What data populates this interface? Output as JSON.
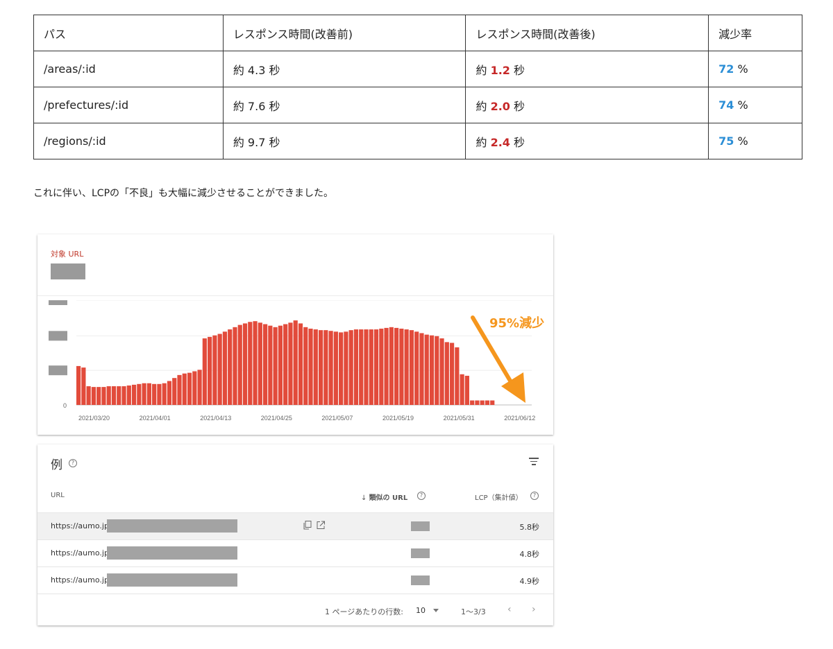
{
  "table": {
    "headers": [
      "パス",
      "レスポンス時間(改善前)",
      "レスポンス時間(改善後)",
      "減少率"
    ],
    "rows": [
      {
        "path": "/areas/:id",
        "before": "約 4.3 秒",
        "after_prefix": "約 ",
        "after_value": "1.2",
        "after_suffix": " 秒",
        "rate_value": "72",
        "rate_suffix": " %"
      },
      {
        "path": "/prefectures/:id",
        "before": "約 7.6 秒",
        "after_prefix": "約 ",
        "after_value": "2.0",
        "after_suffix": " 秒",
        "rate_value": "74",
        "rate_suffix": " %"
      },
      {
        "path": "/regions/:id",
        "before": "約 9.7 秒",
        "after_prefix": "約 ",
        "after_value": "2.4",
        "after_suffix": " 秒",
        "rate_value": "75",
        "rate_suffix": " %"
      }
    ],
    "after_color": "#c62828",
    "rate_color": "#2b8ed6"
  },
  "paragraph": "これに伴い、LCPの「不良」も大幅に減少させることができました。",
  "chart_card": {
    "target_label": "対象 URL",
    "annotation": "95%減少",
    "annotation_color": "#f5961d",
    "y_zero_label": "0"
  },
  "chart_data": {
    "type": "bar",
    "bar_color": "#e24b3b",
    "x_tick_labels": [
      "2021/03/20",
      "2021/04/01",
      "2021/04/13",
      "2021/04/25",
      "2021/05/07",
      "2021/05/19",
      "2021/05/31",
      "2021/06/12"
    ],
    "values": [
      52,
      50,
      25,
      24,
      24,
      24,
      25,
      25,
      25,
      25,
      26,
      27,
      28,
      29,
      29,
      28,
      28,
      29,
      32,
      36,
      40,
      42,
      43,
      45,
      47,
      89,
      91,
      93,
      95,
      98,
      101,
      104,
      107,
      109,
      111,
      112,
      110,
      108,
      106,
      104,
      106,
      108,
      110,
      113,
      109,
      104,
      102,
      101,
      100,
      100,
      99,
      98,
      97,
      98,
      100,
      101,
      101,
      101,
      101,
      101,
      102,
      103,
      104,
      103,
      102,
      101,
      100,
      98,
      96,
      94,
      93,
      92,
      89,
      84,
      83,
      77,
      41,
      39,
      6,
      6,
      6,
      6,
      6
    ],
    "ylim": [
      0,
      140
    ]
  },
  "examples": {
    "title": "例",
    "col_url": "URL",
    "col_similar": "類似の URL",
    "col_lcp": "LCP（集計値）",
    "rows": [
      {
        "url": "https://aumo.jp/",
        "lcp": "5.8秒"
      },
      {
        "url": "https://aumo.jp/",
        "lcp": "4.8秒"
      },
      {
        "url": "https://aumo.jp/",
        "lcp": "4.9秒"
      }
    ],
    "rows_per_page_label": "1 ページあたりの行数:",
    "rows_per_page": "10",
    "range": "1〜3/3"
  }
}
